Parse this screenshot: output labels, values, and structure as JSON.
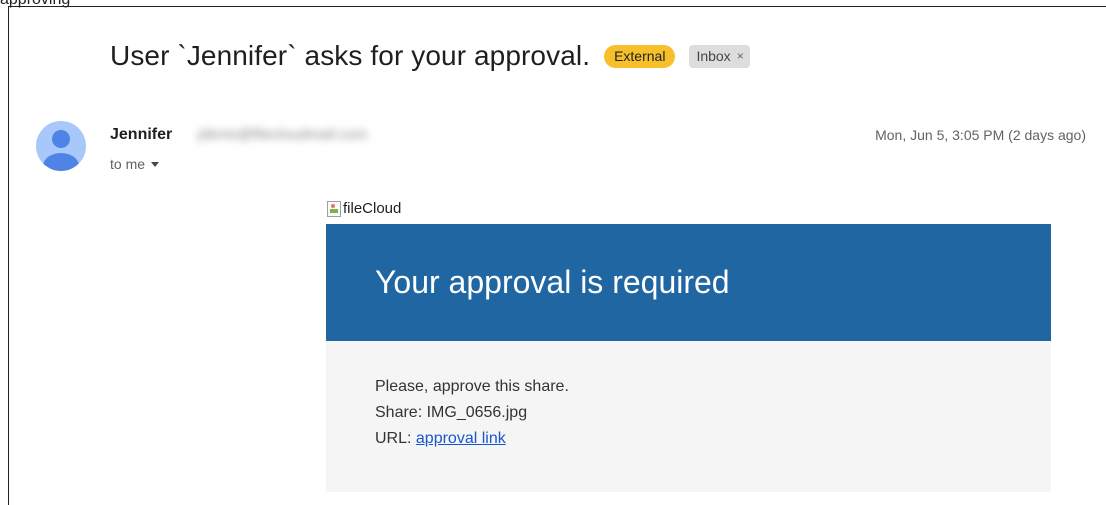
{
  "top_cut_text": "approving",
  "email": {
    "subject": "User `Jennifer` asks for your approval.",
    "labels": {
      "external": "External",
      "inbox": "Inbox",
      "inbox_remove": "×"
    },
    "sender": {
      "name": "Jennifer",
      "email_redacted": "jdenis@filecloudmail.com"
    },
    "to_label": "to me",
    "date": "Mon, Jun 5, 3:05 PM (2 days ago)"
  },
  "body": {
    "logo_alt": "fileCloud",
    "banner_title": "Your approval is required",
    "line1": "Please, approve this share.",
    "share_label": "Share: ",
    "share_value": "IMG_0656.jpg",
    "url_label": "URL: ",
    "url_link_text": "approval link"
  },
  "colors": {
    "banner": "#2066a3",
    "external_badge": "#f7c02b",
    "link": "#1a55d0",
    "avatar_bg": "#a8c7fa"
  }
}
